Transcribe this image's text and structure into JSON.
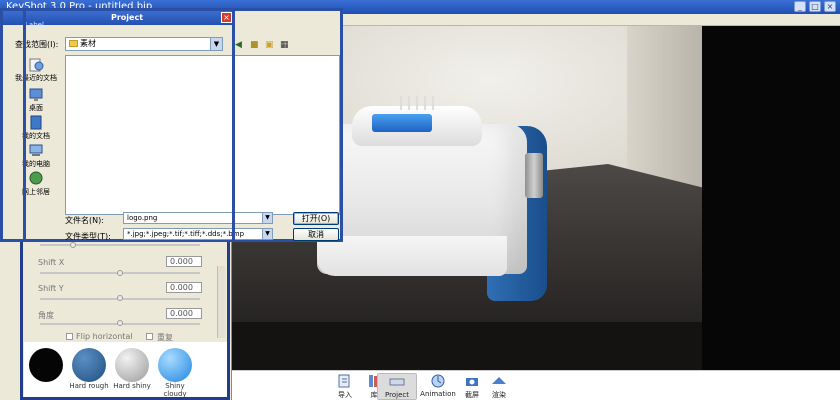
{
  "app": {
    "title": "KeyShot 3.0 Pro - untitled.bip",
    "menu": "文件"
  },
  "window_buttons": [
    "_",
    "□",
    "×"
  ],
  "dialog": {
    "title": "Project",
    "subtitle": "Label",
    "close": "×",
    "lookin_label": "查找范围(I):",
    "lookin_value": "素材",
    "places": [
      "我最近的文档",
      "桌面",
      "我的文档",
      "我的电脑",
      "网上邻居"
    ],
    "filename_label": "文件名(N):",
    "filename_value": "logo.png",
    "filetype_label": "文件类型(T):",
    "filetype_value": "*.jpg;*.jpeg;*.tif;*.tiff;*.dds;*.bmp",
    "open_label": "打开(O)",
    "cancel_label": "取消"
  },
  "panel": {
    "shift_x_label": "Shift X",
    "shift_x_value": "0.000",
    "shift_y_label": "Shift Y",
    "shift_y_value": "0.000",
    "angle_label": "角度",
    "angle_value": "0.000",
    "flip_label": "Flip horizontal",
    "repeat_label": "重复",
    "materials": [
      {
        "label": "",
        "color": "#050505"
      },
      {
        "label": "Hard rough",
        "color": "#2b5d8f"
      },
      {
        "label": "Hard shiny",
        "color": "#c8c8c8"
      },
      {
        "label": "Shiny cloudy",
        "color": "#3fa4f0"
      }
    ]
  },
  "toolbar": {
    "items": [
      "导入",
      "库",
      "Project",
      "Animation",
      "截屏",
      "渲染"
    ],
    "active": "Project"
  },
  "colors": {
    "accent": "#2c4fa6",
    "device_blue": "#2f6fb3"
  }
}
